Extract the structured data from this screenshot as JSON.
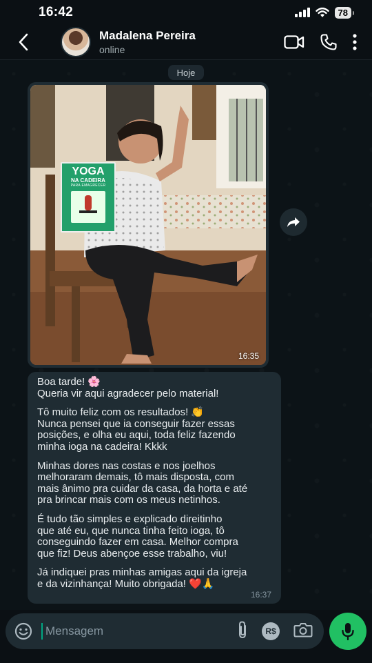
{
  "status_bar": {
    "time": "16:42",
    "battery": "78"
  },
  "header": {
    "name": "Madalena Pereira",
    "status": "online"
  },
  "chat": {
    "date_chip": "Hoje",
    "image_message": {
      "time": "16:35",
      "book_title_line1": "YOGA",
      "book_title_line2": "NA CADEIRA",
      "book_subtitle": "PARA EMAGRECER"
    },
    "text_message": {
      "paragraphs": [
        "Boa tarde! 🌸\nQueria vir aqui agradecer pelo material!",
        "Tô muito feliz com os resultados! 👏\nNunca pensei que ia conseguir fazer essas\nposições, e olha eu aqui, toda feliz fazendo\nminha ioga na cadeira! Kkkk",
        "Minhas dores nas costas e nos joelhos\nmelhoraram demais, tô mais disposta, com\nmais ânimo pra cuidar da casa, da horta e até\npra brincar mais com os meus netinhos.",
        "É tudo tão simples e explicado direitinho\nque até eu, que nunca tinha feito ioga, tô\nconseguindo fazer em casa. Melhor compra\nque fiz! Deus abençoe esse trabalho, viu!",
        "Já indiquei pras minhas amigas aqui da igreja\ne da vizinhança! Muito obrigada! ❤️🙏"
      ],
      "time": "16:37"
    }
  },
  "input_bar": {
    "placeholder": "Mensagem",
    "currency_label": "R$"
  },
  "colors": {
    "accent": "#21c063",
    "bubble": "#1f2c33",
    "background": "#0b1014"
  },
  "icons": [
    "back-arrow-icon",
    "video-call-icon",
    "phone-icon",
    "more-vert-icon",
    "forward-icon",
    "emoji-icon",
    "attach-icon",
    "pix-payment-icon",
    "camera-icon",
    "mic-icon",
    "signal-icon",
    "wifi-icon"
  ]
}
